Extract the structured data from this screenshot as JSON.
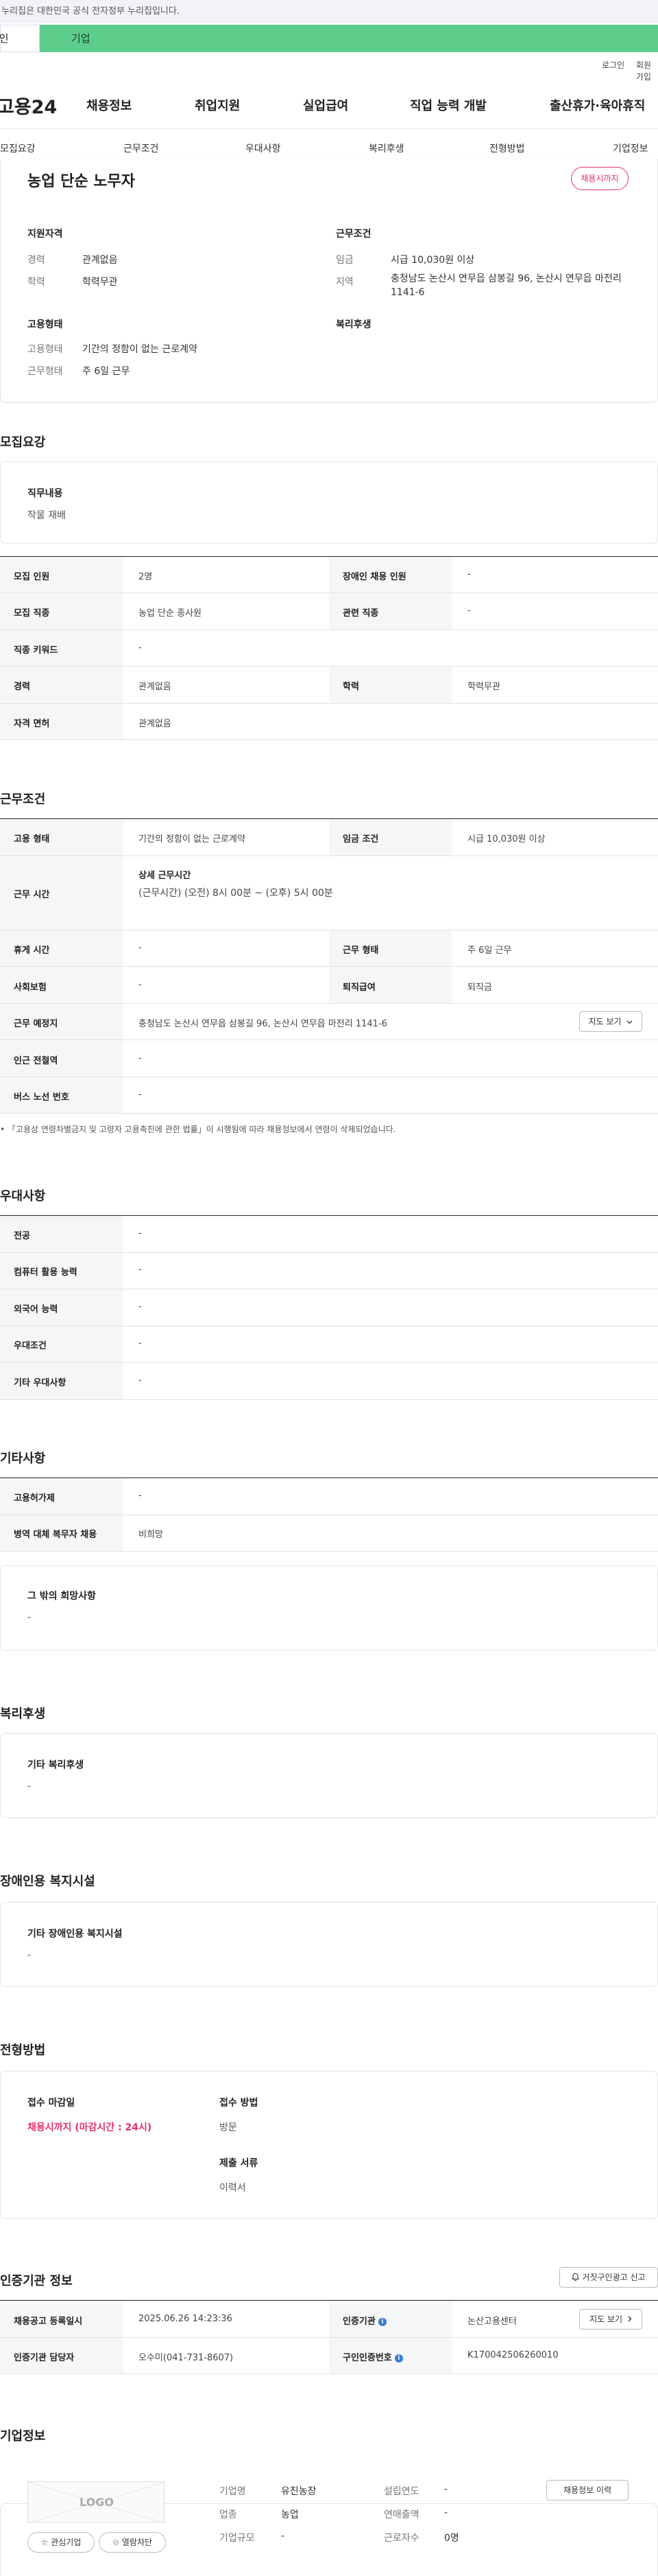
{
  "gov_bar": "이 누리집은 대한민국 공식 전자정부 누리집입니다.",
  "tabs": {
    "personal": "개인",
    "company": "기업"
  },
  "util": {
    "login": "로그인",
    "signup": "회원가입"
  },
  "gnb": {
    "logo": "고용24",
    "items": [
      "채용정보",
      "취업지원",
      "실업급여",
      "직업 능력 개발",
      "출산휴가·육아휴직"
    ]
  },
  "subnav": [
    "모집요강",
    "근무조건",
    "우대사항",
    "복리후생",
    "전형방법",
    "기업정보"
  ],
  "job": {
    "title": "농업 단순 노무자",
    "status_badge": "채용시까지",
    "summary": {
      "qualification_title": "지원자격",
      "career_label": "경력",
      "career_value": "관계없음",
      "edu_label": "학력",
      "edu_value": "학력무관",
      "conditions_title": "근무조건",
      "wage_label": "임금",
      "wage_value": "시급 10,030원 이상",
      "region_label": "지역",
      "region_value": "충청남도 논산시 연무읍 삼봉길 96, 논산시 연무읍 마전리 1141-6",
      "employ_title": "고용형태",
      "employ_label": "고용형태",
      "employ_value": "기간의 정함이 없는 근로계약",
      "worktype_label": "근무형태",
      "worktype_value": "주 6일 근무",
      "welfare_title": "복리후생"
    }
  },
  "recruit": {
    "title": "모집요강",
    "duty_label": "직무내용",
    "duty_value": "작물 재배",
    "rows": [
      {
        "l1": "모집 인원",
        "v1": "2명",
        "l2": "장애인 채용 인원",
        "v2": "-"
      },
      {
        "l1": "모집 직종",
        "v1": "농업 단순 종사원",
        "l2": "관련 직종",
        "v2": "-"
      },
      {
        "l1": "직종 키워드",
        "v1": "-"
      },
      {
        "l1": "경력",
        "v1": "관계없음",
        "l2": "학력",
        "v2": "학력무관"
      },
      {
        "l1": "자격 면허",
        "v1": "관계없음"
      }
    ]
  },
  "conditions": {
    "title": "근무조건",
    "employ_label": "고용 형태",
    "employ_value": "기간의 정함이 없는 근로계약",
    "wage_label": "임금 조건",
    "wage_value": "시급 10,030원 이상",
    "hours_label": "근무 시간",
    "hours_sub": "상세 근무시간",
    "hours_value": "(근무시간) (오전) 8시 00분 ~ (오후) 5시 00분",
    "break_label": "휴게 시간",
    "break_value": "-",
    "worktype_label": "근무 형태",
    "worktype_value": "주 6일 근무",
    "insurance_label": "사회보험",
    "insurance_value": "-",
    "severance_label": "퇴직급여",
    "severance_value": "퇴직금",
    "place_label": "근무 예정지",
    "place_value": "충청남도 논산시 연무읍 삼봉길 96, 논산시 연무읍 마전리 1141-6",
    "map_button": "지도 보기",
    "subway_label": "인근 전철역",
    "subway_value": "-",
    "bus_label": "버스 노선 번호",
    "bus_value": "-",
    "note": "「고용상 연령차별금지 및 고령자 고용촉진에 관한 법률」이 시행됨에 따라 채용정보에서 연령이 삭제되었습니다."
  },
  "preference": {
    "title": "우대사항",
    "rows": [
      {
        "label": "전공",
        "value": "-"
      },
      {
        "label": "컴퓨터 활용 능력",
        "value": "-"
      },
      {
        "label": "외국어 능력",
        "value": "-"
      },
      {
        "label": "우대조건",
        "value": "-"
      },
      {
        "label": "기타 우대사항",
        "value": "-"
      }
    ]
  },
  "etc": {
    "title": "기타사항",
    "rows": [
      {
        "label": "고용허가제",
        "value": "-"
      },
      {
        "label": "병역 대체 복무자 채용",
        "value": "비희망"
      }
    ],
    "other_label": "그 밖의 희망사항",
    "other_value": "-"
  },
  "welfare": {
    "title": "복리후생",
    "label": "기타 복리후생",
    "value": "-"
  },
  "disability": {
    "title": "장애인용 복지시설",
    "label": "기타 장애인용 복지시설",
    "value": "-"
  },
  "selection": {
    "title": "전형방법",
    "deadline_label": "접수 마감일",
    "deadline_value": "채용시까지 (마감시간 : 24시)",
    "method_label": "접수 방법",
    "method_value": "방문",
    "docs_label": "제출 서류",
    "docs_value": "이력서"
  },
  "agency": {
    "title": "인증기관 정보",
    "report_button": "거짓구인광고 신고",
    "reg_label": "채용공고 등록일시",
    "reg_value": "2025.06.26 14:23:36",
    "org_label": "인증기관",
    "org_value": "논산고용센터",
    "view_button": "지도 보기",
    "manager_label": "인증기관 담당자",
    "manager_value": "오수미(041-731-8607)",
    "job_no_label": "구인인증번호",
    "job_no_value": "K170042506260010"
  },
  "company": {
    "title": "기업정보",
    "logo_text": "LOGO",
    "fav_button": "관심기업",
    "block_button": "열람차단",
    "name_label": "기업명",
    "name_value": "유진농장",
    "industry_label": "업종",
    "industry_value": "농업",
    "size_label": "기업규모",
    "size_value": "-",
    "founded_label": "설립연도",
    "founded_value": "-",
    "sales_label": "연매출액",
    "sales_value": "-",
    "employees_label": "근로자수",
    "employees_value": "0명",
    "history_button": "채용정보 이력"
  },
  "colors": {
    "brand_green": "#5ccd8b",
    "accent_pink": "#e3306a",
    "info_blue": "#3a7bd5"
  }
}
